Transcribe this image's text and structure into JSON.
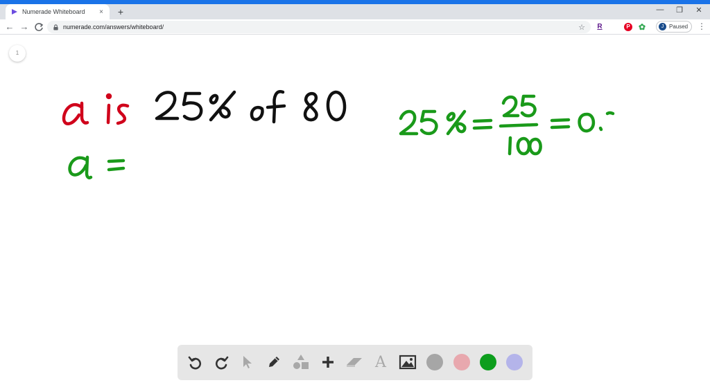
{
  "browser": {
    "tab": {
      "title": "Numerade Whiteboard",
      "close_glyph": "×"
    },
    "new_tab_glyph": "+",
    "window_controls": {
      "minimize": "—",
      "restore": "❐",
      "close": "✕"
    },
    "nav": {
      "back": "←",
      "forward": "→",
      "reload": "C"
    },
    "address": {
      "url": "numerade.com/answers/whiteboard/"
    },
    "bookmark_glyph": "☆",
    "extensions": [
      {
        "name": "r-extension-icon",
        "label": "R",
        "color": "#5f1a8c"
      },
      {
        "name": "pinterest-icon",
        "label": "P",
        "color": "#e60023"
      },
      {
        "name": "google-photos-icon",
        "label": "✿",
        "color": "#34a853"
      }
    ],
    "profile": {
      "initial": "J",
      "status": "Paused"
    },
    "menu_glyph": "⋮"
  },
  "whiteboard": {
    "page_number": "1",
    "ink_colors": {
      "red": "#d0021b",
      "black": "#111111",
      "green": "#1a9a1a"
    },
    "toolbar": {
      "tools": [
        {
          "name": "undo-icon"
        },
        {
          "name": "redo-icon"
        },
        {
          "name": "pointer-icon"
        },
        {
          "name": "pen-icon"
        },
        {
          "name": "shapes-icon"
        },
        {
          "name": "plus-icon"
        },
        {
          "name": "eraser-icon"
        },
        {
          "name": "text-icon",
          "label": "A"
        },
        {
          "name": "image-icon"
        }
      ],
      "swatches": [
        {
          "name": "color-gray-swatch",
          "color": "#a6a6a6"
        },
        {
          "name": "color-pink-swatch",
          "color": "#e8a8ae"
        },
        {
          "name": "color-green-swatch",
          "color": "#0d9e1d"
        },
        {
          "name": "color-lavender-swatch",
          "color": "#b4b4ea"
        }
      ]
    }
  }
}
